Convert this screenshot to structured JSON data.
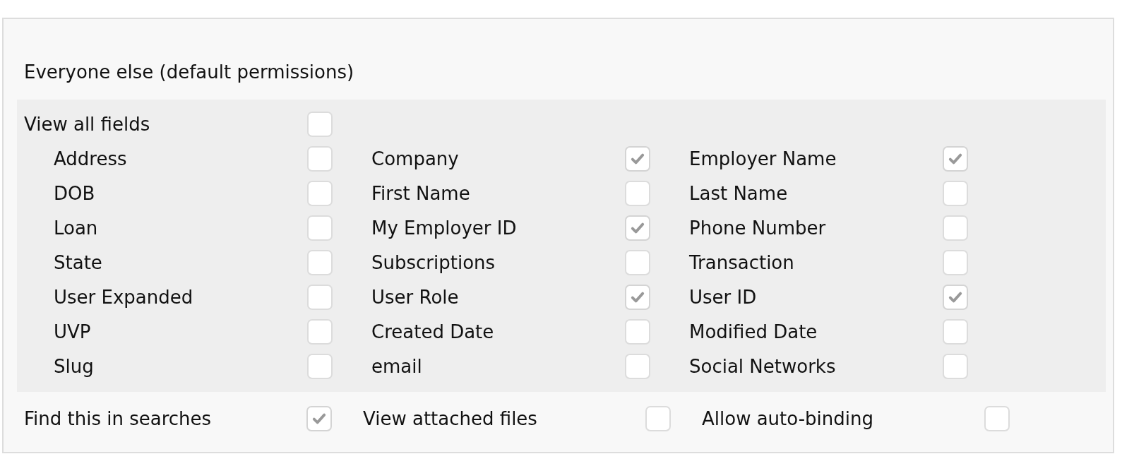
{
  "section_title": "Everyone else (default permissions)",
  "view_all": {
    "label": "View all fields",
    "checked": false
  },
  "fields": [
    {
      "label": "Address",
      "checked": false
    },
    {
      "label": "Company",
      "checked": true
    },
    {
      "label": "Employer Name",
      "checked": true
    },
    {
      "label": "DOB",
      "checked": false
    },
    {
      "label": "First Name",
      "checked": false
    },
    {
      "label": "Last Name",
      "checked": false
    },
    {
      "label": "Loan",
      "checked": false
    },
    {
      "label": "My Employer ID",
      "checked": true
    },
    {
      "label": "Phone Number",
      "checked": false
    },
    {
      "label": "State",
      "checked": false
    },
    {
      "label": "Subscriptions",
      "checked": false
    },
    {
      "label": "Transaction",
      "checked": false
    },
    {
      "label": "User Expanded",
      "checked": false
    },
    {
      "label": "User Role",
      "checked": true
    },
    {
      "label": "User ID",
      "checked": true
    },
    {
      "label": "UVP",
      "checked": false
    },
    {
      "label": "Created Date",
      "checked": false
    },
    {
      "label": "Modified Date",
      "checked": false
    },
    {
      "label": "Slug",
      "checked": false
    },
    {
      "label": "email",
      "checked": false
    },
    {
      "label": "Social Networks",
      "checked": false
    }
  ],
  "options": [
    {
      "label": "Find this in searches",
      "checked": true
    },
    {
      "label": "View attached files",
      "checked": false
    },
    {
      "label": "Allow auto-binding",
      "checked": false
    }
  ]
}
